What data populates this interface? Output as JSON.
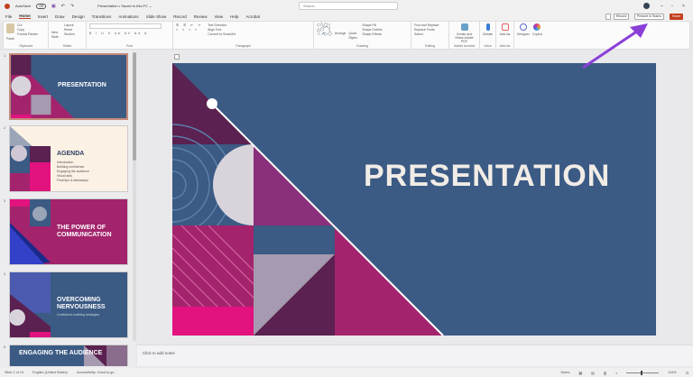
{
  "titlebar": {
    "autosave": "AutoSave",
    "toggle": "Off",
    "doc_title": "Presentation • Saved to this PC ⌄",
    "search_placeholder": "Search"
  },
  "menu": [
    "File",
    "Home",
    "Insert",
    "Draw",
    "Design",
    "Transitions",
    "Animations",
    "Slide Show",
    "Record",
    "Review",
    "View",
    "Help",
    "Acrobat"
  ],
  "ribbon": {
    "clipboard": {
      "label": "Clipboard",
      "items": [
        "Paste",
        "Cut",
        "Copy",
        "Format Painter"
      ]
    },
    "slides": {
      "label": "Slides",
      "items": [
        "New Slide",
        "Layout",
        "Reset",
        "Section"
      ]
    },
    "font": {
      "label": "Font"
    },
    "paragraph": {
      "label": "Paragraph",
      "items": [
        "Text Direction",
        "Align Text",
        "Convert to SmartArt"
      ]
    },
    "drawing": {
      "label": "Drawing",
      "items": [
        "Arrange",
        "Quick Styles",
        "Shape Fill",
        "Shape Outline",
        "Shape Effects"
      ]
    },
    "editing": {
      "label": "Editing",
      "items": [
        "Find and Replace",
        "Replace Fonts",
        "Select"
      ]
    },
    "acrobat": {
      "label": "Adobe Acrobat",
      "items": [
        "Create and Share Adobe PDF"
      ]
    },
    "voice": {
      "label": "Voice",
      "items": [
        "Dictate"
      ]
    },
    "addins": {
      "label": "Add-ins",
      "items": [
        "Add-ins"
      ]
    },
    "designer": {
      "items": [
        "Designer",
        "Copilot"
      ]
    }
  },
  "right_buttons": {
    "record": "Record",
    "present_teams": "Present in Teams",
    "share": "Share"
  },
  "slides": [
    {
      "num": "1",
      "title": "PRESENTATION"
    },
    {
      "num": "2",
      "title": "AGENDA",
      "bullets": [
        "Introduction",
        "Building confidence",
        "Engaging the audience",
        "Visual aids",
        "Final tips & takeaways"
      ]
    },
    {
      "num": "3",
      "title": "THE POWER OF COMMUNICATION"
    },
    {
      "num": "4",
      "title": "OVERCOMING NERVOUSNESS",
      "subtitle": "Confidence-building strategies"
    },
    {
      "num": "5",
      "title": "ENGAGING THE AUDIENCE"
    }
  ],
  "main_slide": {
    "title": "PRESENTATION"
  },
  "notes_placeholder": "Click to add notes",
  "status": {
    "slide": "Slide 1 of 13",
    "language": "English (United States)",
    "accessibility": "Accessibility: Good to go",
    "notes": "Notes",
    "zoom": "144%"
  },
  "colors": {
    "blue": "#3b5a84",
    "magenta": "#a3246c",
    "purple": "#5b2150",
    "pink": "#e2127f",
    "share": "#c43e1c",
    "arrow": "#8a3fd8"
  }
}
